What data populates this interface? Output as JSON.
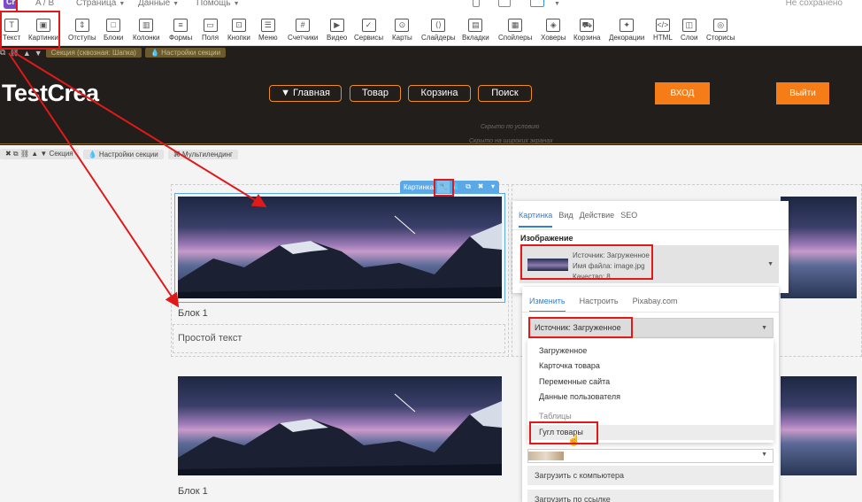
{
  "topmenu": {
    "ab": "A / B",
    "page": "Страница",
    "data": "Данные",
    "help": "Помощь",
    "status": "Не сохранено"
  },
  "toolbar": [
    {
      "label": "Текст",
      "icon": "text-icon"
    },
    {
      "label": "Картинки",
      "icon": "image-icon"
    },
    {
      "label": "Отступы",
      "icon": "padding-icon"
    },
    {
      "label": "Блоки",
      "icon": "blocks-icon"
    },
    {
      "label": "Колонки",
      "icon": "columns-icon"
    },
    {
      "label": "Формы",
      "icon": "form-icon"
    },
    {
      "label": "Поля",
      "icon": "field-icon"
    },
    {
      "label": "Кнопки",
      "icon": "button-icon"
    },
    {
      "label": "Меню",
      "icon": "menu-icon"
    },
    {
      "label": "Счетчики",
      "icon": "counter-icon"
    },
    {
      "label": "Видео",
      "icon": "video-icon"
    },
    {
      "label": "Сервисы",
      "icon": "services-icon"
    },
    {
      "label": "Карты",
      "icon": "map-icon"
    },
    {
      "label": "Слайдеры",
      "icon": "slider-icon"
    },
    {
      "label": "Вкладки",
      "icon": "tabs-icon"
    },
    {
      "label": "Спойлеры",
      "icon": "spoiler-icon"
    },
    {
      "label": "Ховеры",
      "icon": "hover-icon"
    },
    {
      "label": "Корзина",
      "icon": "cart-icon"
    },
    {
      "label": "Декорации",
      "icon": "decor-icon"
    },
    {
      "label": "HTML",
      "icon": "html-icon"
    },
    {
      "label": "Слои",
      "icon": "layers-icon"
    },
    {
      "label": "Сторисы",
      "icon": "stories-icon"
    }
  ],
  "header_section": {
    "chip_section": "Секция (сквозная: Шапка)",
    "chip_settings": "Настройки секции",
    "brand": "TestCrea",
    "nav": [
      "▼ Главная",
      "Товар",
      "Корзина",
      "Поиск"
    ],
    "login": "ВХОД",
    "logout": "Выйти",
    "hidden_cond": "Скрыто по условию",
    "hidden_wide": "Скрыто на широких экранах"
  },
  "section2": {
    "section": "Секция",
    "settings": "Настройки секции",
    "multilanding": "Мультилендинг"
  },
  "cards": {
    "block1_title": "Блок 1",
    "block1_text": "Простой текст",
    "block2_title": "Блок 1"
  },
  "picbar": {
    "label": "Картинка"
  },
  "panel": {
    "tabs": [
      "Картинка",
      "Вид",
      "Действие",
      "SEO"
    ],
    "section_title": "Изображение",
    "source": "Источник: Загруженное",
    "file": "Имя файла: image.jpg",
    "quality": "Качество: 8"
  },
  "dpanel": {
    "tabs": [
      "Изменить",
      "Настроить",
      "Pixabay.com"
    ],
    "select_value": "Источник: Загруженное",
    "options": [
      "Загруженное",
      "Карточка товара",
      "Переменные сайта",
      "Данные пользователя"
    ],
    "group": "Таблицы",
    "highlighted": "Гугл товары",
    "upload_pc": "Загрузить с компьютера",
    "upload_link": "Загрузить по ссылке"
  },
  "colors": {
    "accent": "#f57c16",
    "header_bg": "#211e1b",
    "highlight": "#e01919",
    "selection": "#5aa9e6"
  }
}
